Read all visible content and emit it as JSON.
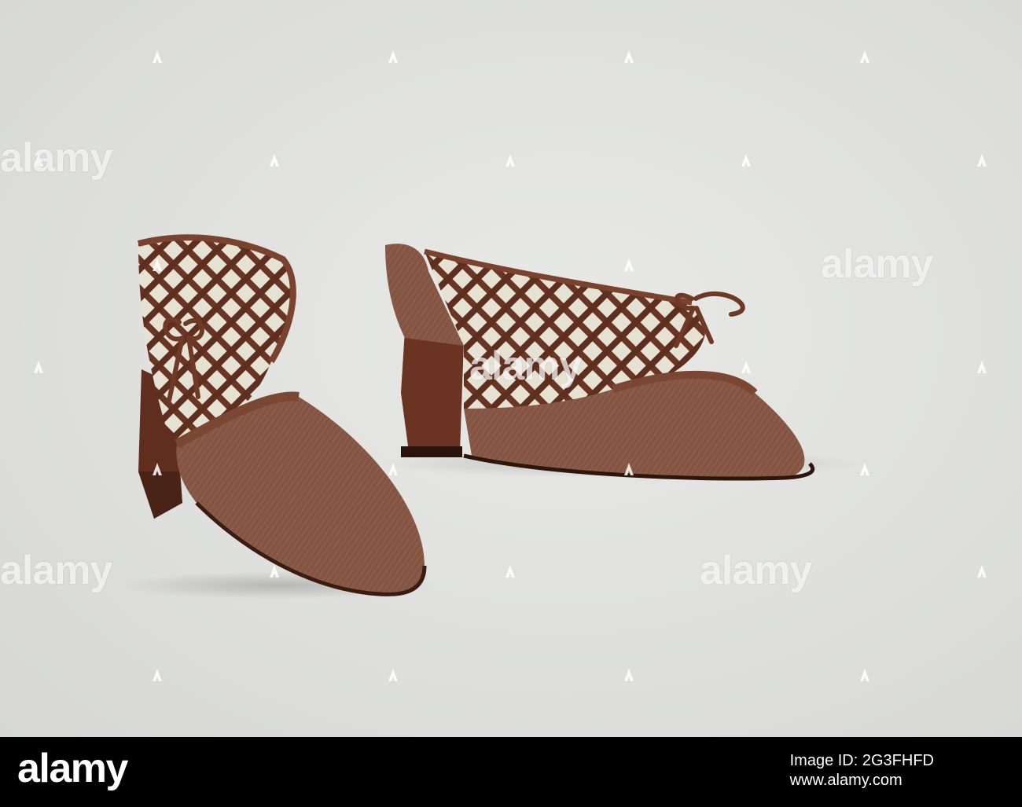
{
  "watermark": {
    "brand": "alamy",
    "colors": {
      "watermark": "#ffffff",
      "footer_bg": "#000000",
      "footer_text": "#ffffff"
    }
  },
  "photo": {
    "subject_icons": [
      "left-shoe",
      "right-shoe"
    ],
    "colors": {
      "background": "#e0e1df",
      "fabric": "#8a5a48",
      "leather": "#6e3a26",
      "heel": "#6a3322",
      "lining": "#e8e4d6"
    }
  },
  "footer": {
    "logo": "alamy",
    "image_id_label": "Image ID: 2G3FHFD",
    "site": "www.alamy.com"
  }
}
